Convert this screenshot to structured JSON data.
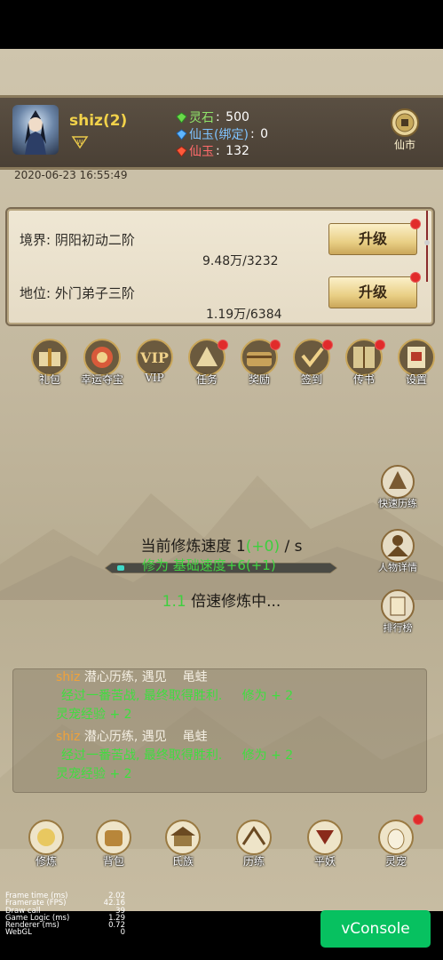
{
  "header": {
    "username": "shiz(2)",
    "currencies": [
      {
        "label": "灵石",
        "value": "500",
        "icon": "green-gem-icon",
        "color": "#8fe36a"
      },
      {
        "label": "仙玉(绑定)",
        "value": "0",
        "icon": "blue-gem-icon",
        "color": "#7fc3ff"
      },
      {
        "label": "仙玉",
        "value": "132",
        "icon": "red-gem-icon",
        "color": "#ff6b6b"
      }
    ],
    "market_label": "仙市"
  },
  "timestamp": "2020-06-23 16:55:49",
  "realm_panel": {
    "realm_label": "境界: 阴阳初动二阶",
    "realm_progress": "9.48万/3232",
    "status_label": "地位: 外门弟子三阶",
    "status_progress": "1.19万/6384",
    "upgrade_label": "升级"
  },
  "top_icons": [
    {
      "label": "礼包",
      "icon": "gift-box-icon",
      "badge": false
    },
    {
      "label": "幸运夺宝",
      "icon": "lucky-treasure-icon",
      "badge": false
    },
    {
      "label": "VIP",
      "icon": "vip-icon",
      "badge": false
    },
    {
      "label": "任务",
      "icon": "task-icon",
      "badge": true
    },
    {
      "label": "奖励",
      "icon": "reward-chest-icon",
      "badge": true
    },
    {
      "label": "签到",
      "icon": "sign-in-icon",
      "badge": true
    },
    {
      "label": "传书",
      "icon": "letter-book-icon",
      "badge": true
    },
    {
      "label": "设置",
      "icon": "settings-scroll-icon",
      "badge": false
    }
  ],
  "side_buttons": [
    {
      "label": "快速历练",
      "icon": "quick-training-icon"
    },
    {
      "label": "人物详情",
      "icon": "character-detail-icon"
    },
    {
      "label": "排行榜",
      "icon": "leaderboard-icon"
    }
  ],
  "cultivation": {
    "speed_prefix": "当前修炼速度",
    "speed_value": "1",
    "speed_bonus": "(+0)",
    "speed_unit": "/ s",
    "base_label": "修为 基础速度+6(+1)",
    "mode_multiplier": "1.1",
    "mode_text": "倍速修炼中..."
  },
  "log": [
    {
      "name": "shiz",
      "action": "潜心历练, 遇见",
      "target": "黾蛙",
      "result": "经过一番苦战, 最终取得胜利.",
      "gain1": "修为  + 2",
      "gain2": "灵宠经验 + 2"
    },
    {
      "name": "shiz",
      "action": "潜心历练, 遇见",
      "target": "黾蛙",
      "result": "经过一番苦战, 最终取得胜利.",
      "gain1": "修为  + 2",
      "gain2": "灵宠经验 + 2"
    }
  ],
  "bottom_nav": [
    {
      "label": "修炼",
      "icon": "cultivate-icon",
      "badge": false
    },
    {
      "label": "背包",
      "icon": "backpack-icon",
      "badge": false
    },
    {
      "label": "氏族",
      "icon": "clan-icon",
      "badge": false
    },
    {
      "label": "历练",
      "icon": "training-icon",
      "badge": false
    },
    {
      "label": "平妖",
      "icon": "demon-subdue-icon",
      "badge": false
    },
    {
      "label": "灵宠",
      "icon": "spirit-pet-icon",
      "badge": true
    }
  ],
  "stats": [
    {
      "label": "Frame time (ms)",
      "value": "2.02"
    },
    {
      "label": "Framerate (FPS)",
      "value": "42.16"
    },
    {
      "label": "Draw call",
      "value": "39"
    },
    {
      "label": "Game Logic (ms)",
      "value": "1.29"
    },
    {
      "label": "Renderer (ms)",
      "value": "0.72"
    },
    {
      "label": "WebGL",
      "value": "0"
    }
  ],
  "vconsole_label": "vConsole",
  "colors": {
    "gold_name": "#f2d24a",
    "green_text": "#3fcf3f",
    "badge_red": "#e12b2b",
    "vconsole_green": "#07c160"
  }
}
